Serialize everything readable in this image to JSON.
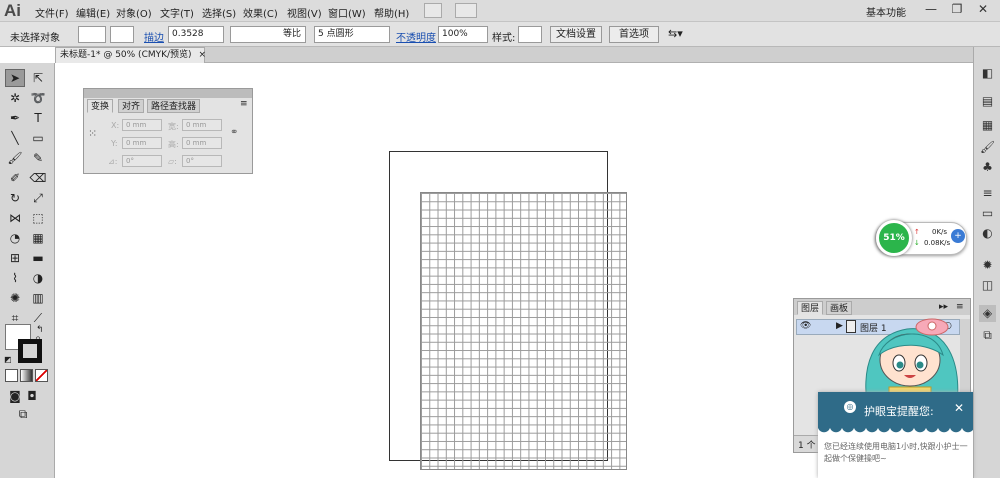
{
  "app": {
    "logo": "Ai"
  },
  "menu": [
    "文件(F)",
    "编辑(E)",
    "对象(O)",
    "文字(T)",
    "选择(S)",
    "效果(C)",
    "视图(V)",
    "窗口(W)",
    "帮助(H)"
  ],
  "workspace": "基本功能",
  "window_controls": {
    "minimize": "—",
    "restore": "❐",
    "close": "✕"
  },
  "control": {
    "selection": "未选择对象",
    "stroke_label": "描边",
    "stroke_value": "0.3528",
    "profile": "等比",
    "brush": "5 点圆形",
    "opacity_label": "不透明度",
    "opacity_value": "100%",
    "style_label": "样式:",
    "doc_setup": "文档设置",
    "prefs": "首选项"
  },
  "document_tab": {
    "title": "未标题-1* @ 50% (CMYK/预览)",
    "close": "×"
  },
  "transform_panel": {
    "tabs": [
      "变换",
      "对齐",
      "路径查找器"
    ],
    "x": "0 mm",
    "y": "0 mm",
    "w": "0 mm",
    "h": "0 mm",
    "rotate": "0°",
    "shear": "0°",
    "x_label": "X:",
    "y_label": "Y:",
    "w_label": "宽:",
    "h_label": "高:"
  },
  "layers_panel": {
    "tabs": [
      "图层",
      "画板"
    ],
    "layer_name": "图层 1",
    "footer": "1 个"
  },
  "speed_widget": {
    "percent": "51%",
    "up": "0K/s",
    "down": "0.08K/s"
  },
  "popup": {
    "title": "护眼宝提醒您:",
    "body": "您已经连续使用电脑1小时,快跟小护士一起做个保健操吧~",
    "close": "✕"
  },
  "colors": {
    "accent": "#2bb54b",
    "popup": "#2f6b88",
    "link": "#1a4fb0"
  }
}
